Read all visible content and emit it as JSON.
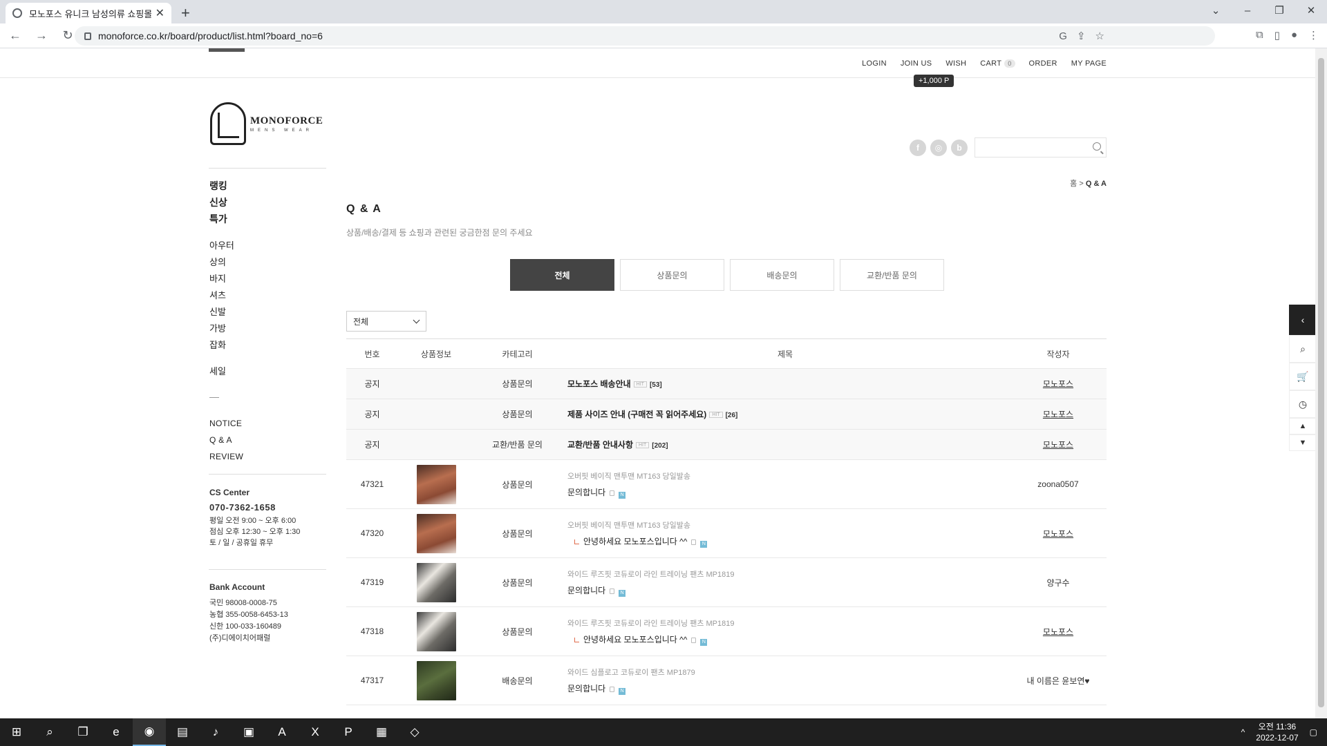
{
  "browser": {
    "tab_title": "모노포스 유니크 남성의류 쇼핑몰",
    "url": "monoforce.co.kr/board/product/list.html?board_no=6"
  },
  "topmenu": {
    "login": "LOGIN",
    "join": "JOIN US",
    "wish": "WISH",
    "cart": "CART",
    "cart_count": "0",
    "order": "ORDER",
    "mypage": "MY PAGE",
    "point_tip": "+1,000 P"
  },
  "logo": {
    "brand": "MONOFORCE",
    "sub": "MENS WEAR"
  },
  "sidebar": {
    "main": [
      "랭킹",
      "신상",
      "특가"
    ],
    "categories": [
      "아우터",
      "상의",
      "바지",
      "셔츠",
      "신발",
      "가방",
      "잡화"
    ],
    "sale": "세일",
    "board": [
      "NOTICE",
      "Q & A",
      "REVIEW"
    ]
  },
  "cs": {
    "title": "CS Center",
    "tel": "070-7362-1658",
    "lines": [
      "평일 오전 9:00 ~ 오후 6:00",
      "점심 오후 12:30 ~ 오후 1:30",
      "토 / 일 / 공휴일 휴무"
    ]
  },
  "bank": {
    "title": "Bank Account",
    "lines": [
      "국민 98008-0008-75",
      "농협 355-0058-6453-13",
      "신한 100-033-160489",
      "(주)디에이치어패럴"
    ]
  },
  "social": [
    "f",
    "◎",
    "b"
  ],
  "breadcrumb": {
    "home": "홈",
    "sep": ">",
    "current": "Q & A"
  },
  "page": {
    "title": "Q & A",
    "desc": "상품/배송/결제 등 쇼핑과 관련된 궁금한점 문의 주세요"
  },
  "tabs": [
    "전체",
    "상품문의",
    "배송문의",
    "교환/반품 문의"
  ],
  "filter": {
    "selected": "전체"
  },
  "table": {
    "headers": {
      "no": "번호",
      "img": "상품정보",
      "cat": "카테고리",
      "subject": "제목",
      "writer": "작성자"
    },
    "notices": [
      {
        "no": "공지",
        "cat": "상품문의",
        "subject": "모노포스 배송안내",
        "hit": "HIT",
        "count": "[53]",
        "writer": "모노포스"
      },
      {
        "no": "공지",
        "cat": "상품문의",
        "subject": "제품 사이즈 안내 (구매전 꼭 읽어주세요)",
        "hit": "HIT",
        "count": "[26]",
        "writer": "모노포스"
      },
      {
        "no": "공지",
        "cat": "교환/반품 문의",
        "subject": "교환/반품 안내사항",
        "hit": "HIT",
        "count": "[202]",
        "writer": "모노포스"
      }
    ],
    "posts": [
      {
        "no": "47321",
        "thumb": "brown",
        "cat": "상품문의",
        "product": "오버핏 베이직 맨투맨 MT163 당일발송",
        "subject": "문의합니다",
        "reply": false,
        "writer": "zoona0507",
        "underline": false
      },
      {
        "no": "47320",
        "thumb": "brown",
        "cat": "상품문의",
        "product": "오버핏 베이직 맨투맨 MT163 당일발송",
        "subject": "안녕하세요 모노포스입니다 ^^",
        "reply": true,
        "writer": "모노포스",
        "underline": true
      },
      {
        "no": "47319",
        "thumb": "gray",
        "cat": "상품문의",
        "product": "와이드 루즈핏 코듀로이 라인 트레이닝 팬츠 MP1819",
        "subject": "문의합니다",
        "reply": false,
        "writer": "양구수",
        "underline": false
      },
      {
        "no": "47318",
        "thumb": "gray",
        "cat": "상품문의",
        "product": "와이드 루즈핏 코듀로이 라인 트레이닝 팬츠 MP1819",
        "subject": "안녕하세요 모노포스입니다 ^^",
        "reply": true,
        "writer": "모노포스",
        "underline": true
      },
      {
        "no": "47317",
        "thumb": "green",
        "cat": "배송문의",
        "product": "와이드 심플로고 코듀로이 팬츠 MP1879",
        "subject": "문의합니다",
        "reply": false,
        "writer": "내 이름은 윤보연♥",
        "underline": false
      }
    ]
  },
  "new_icon": "N",
  "taskbar": {
    "time": "오전 11:36",
    "date": "2022-12-07"
  },
  "colors": {
    "accent_dark": "#444444",
    "reply_mark": "#e06a4a",
    "new_badge": "#74bbd6"
  }
}
